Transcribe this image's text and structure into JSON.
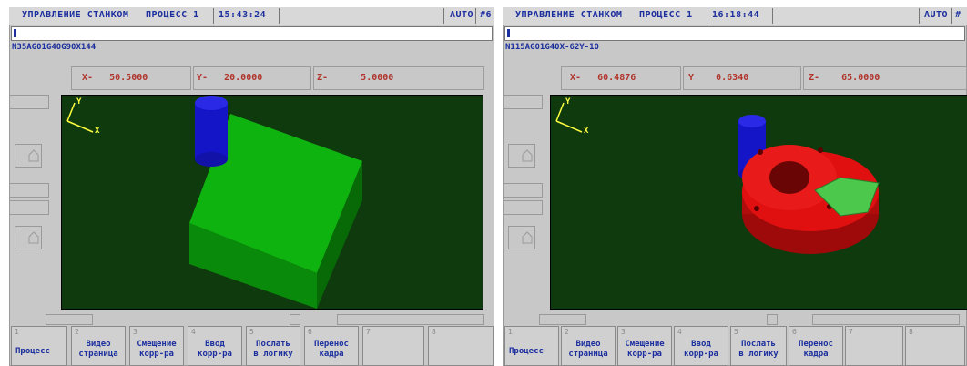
{
  "panels": [
    {
      "title": "УПРАВЛЕНИЕ СТАНКОМ",
      "process": "ПРОЦЕСС 1",
      "time": "15:43:24",
      "mode": "AUTO",
      "mode_extra": "#6",
      "program": "N35AG01G40G90X144",
      "coords": {
        "x_label": "X-",
        "x_value": "50.5000",
        "y_label": "Y-",
        "y_value": "20.0000",
        "z_label": "Z-",
        "z_value": "5.0000"
      },
      "axis_x": "X",
      "axis_y": "Y",
      "part_color": "#0fb30f",
      "tool_color": "#1515c8",
      "fkeys": [
        {
          "num": "1",
          "label": "Процесс"
        },
        {
          "num": "2",
          "label": "Видео\nстраница"
        },
        {
          "num": "3",
          "label": "Смещение\nкорр-ра"
        },
        {
          "num": "4",
          "label": "Ввод\nкорр-ра"
        },
        {
          "num": "5",
          "label": "Послать\nв логику"
        },
        {
          "num": "6",
          "label": "Перенос\nкадра"
        },
        {
          "num": "7",
          "label": ""
        },
        {
          "num": "8",
          "label": ""
        }
      ]
    },
    {
      "title": "УПРАВЛЕНИЕ СТАНКОМ",
      "process": "ПРОЦЕСС 1",
      "time": "16:18:44",
      "mode": "AUTO",
      "mode_extra": "#",
      "program": "N115AG01G40X-62Y-10",
      "coords": {
        "x_label": "X-",
        "x_value": "60.4876",
        "y_label": "Y",
        "y_value": "0.6340",
        "z_label": "Z-",
        "z_value": "65.0000"
      },
      "axis_x": "X",
      "axis_y": "Y",
      "part_color": "#e01010",
      "tool_color": "#1515c8",
      "fkeys": [
        {
          "num": "1",
          "label": "Процесс"
        },
        {
          "num": "2",
          "label": "Видео\nстраница"
        },
        {
          "num": "3",
          "label": "Смещение\nкорр-ра"
        },
        {
          "num": "4",
          "label": "Ввод\nкорр-ра"
        },
        {
          "num": "5",
          "label": "Послать\nв логику"
        },
        {
          "num": "6",
          "label": "Перенос\nкадра"
        },
        {
          "num": "7",
          "label": ""
        },
        {
          "num": "8",
          "label": ""
        }
      ]
    }
  ]
}
